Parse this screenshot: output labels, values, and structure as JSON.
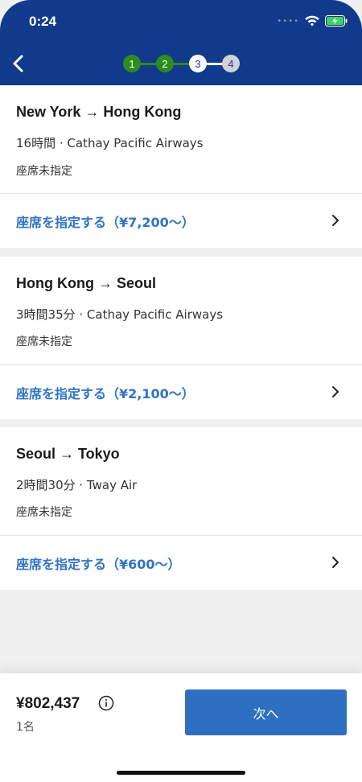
{
  "status_bar": {
    "time": "0:24",
    "signal": "••••"
  },
  "nav": {
    "steps": [
      {
        "label": "1",
        "state": "done"
      },
      {
        "label": "2",
        "state": "done"
      },
      {
        "label": "3",
        "state": "current"
      },
      {
        "label": "4",
        "state": "todo"
      }
    ]
  },
  "segments": [
    {
      "route": "New York → Hong Kong",
      "meta": "16時間 · Cathay Pacific Airways",
      "seat_status": "座席未指定",
      "select_label": "座席を指定する（¥7,200〜）"
    },
    {
      "route": "Hong Kong → Seoul",
      "meta": "3時間35分 · Cathay Pacific Airways",
      "seat_status": "座席未指定",
      "select_label": "座席を指定する（¥2,100〜）"
    },
    {
      "route": "Seoul → Tokyo",
      "meta": "2時間30分 · Tway Air",
      "seat_status": "座席未指定",
      "select_label": "座席を指定する（¥600〜）"
    }
  ],
  "footer": {
    "total_price": "¥802,437",
    "passengers": "1名",
    "next_label": "次へ"
  },
  "colors": {
    "header": "#123a8c",
    "step_done": "#2e8b20",
    "link": "#2f73c7",
    "button": "#2f6fc2"
  }
}
